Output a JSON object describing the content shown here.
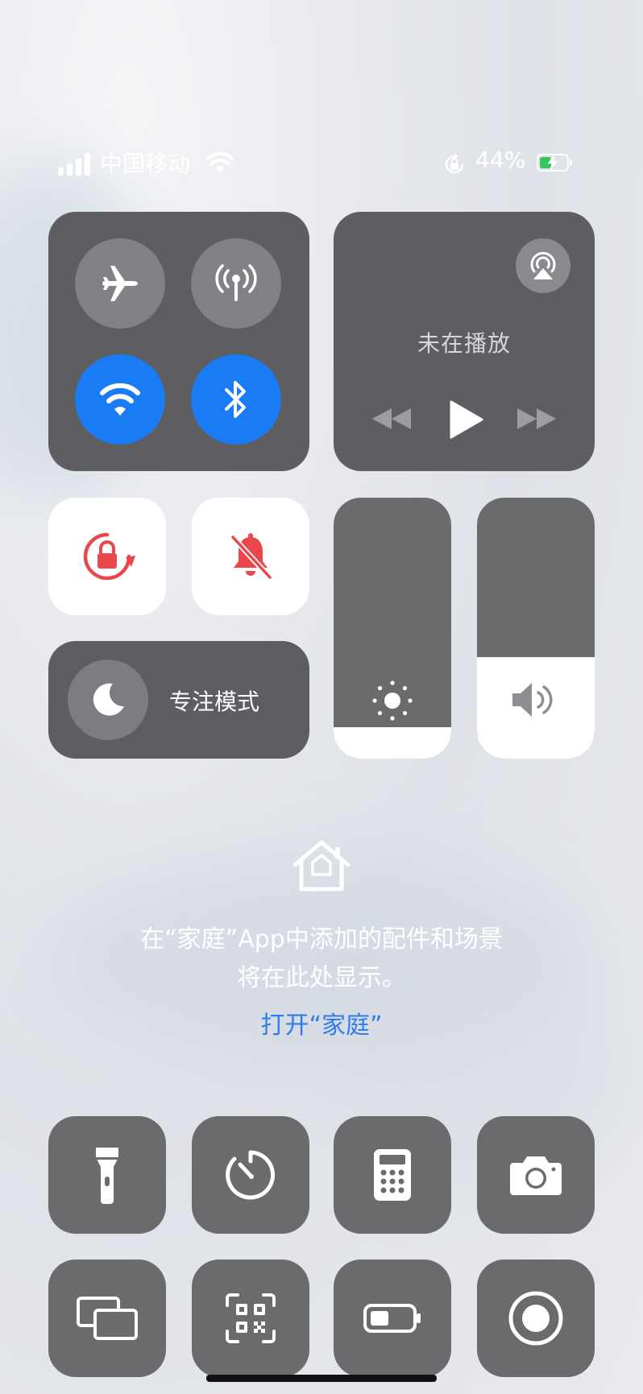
{
  "status_bar": {
    "carrier": "中国移动",
    "battery_percent": "44%",
    "battery_level": 0.44,
    "icons": [
      "signal-icon",
      "wifi-icon",
      "orientation-lock-icon",
      "battery-charging-icon"
    ]
  },
  "connectivity": {
    "airplane_mode": false,
    "cellular_data": false,
    "wifi": true,
    "bluetooth": true,
    "accent_color": "#1a7cf5"
  },
  "media": {
    "status": "未在播放",
    "icons": [
      "airplay-icon",
      "rewind-icon",
      "play-icon",
      "fast-forward-icon"
    ]
  },
  "toggles": {
    "orientation_lock": true,
    "silent_mode": true,
    "active_color": "#e9474b"
  },
  "focus": {
    "label": "专注模式"
  },
  "sliders": {
    "brightness_level": 0.12,
    "volume_level": 0.39
  },
  "home": {
    "message_line1": "在“家庭”App中添加的配件和场景",
    "message_line2": "将在此处显示。",
    "open_link": "打开“家庭”"
  },
  "shortcuts": {
    "row1": [
      "flashlight-icon",
      "timer-icon",
      "calculator-icon",
      "camera-icon"
    ],
    "row2": [
      "screen-mirroring-icon",
      "qr-code-scanner-icon",
      "low-power-mode-icon",
      "screen-recording-icon"
    ]
  }
}
